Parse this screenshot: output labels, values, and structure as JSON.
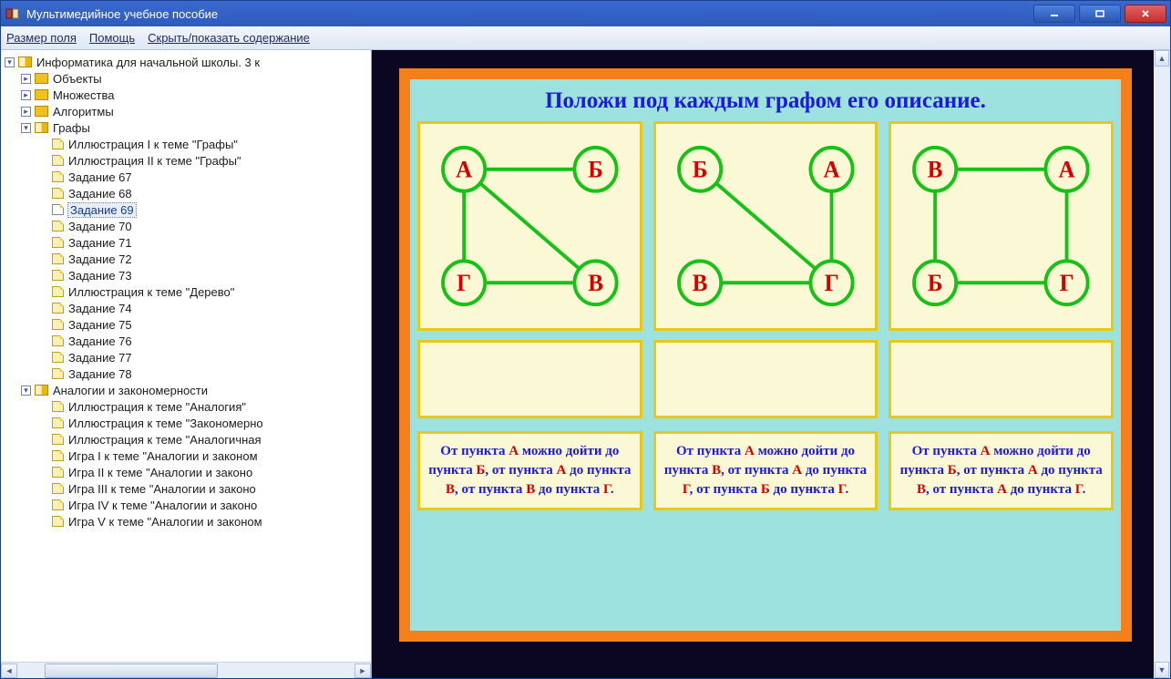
{
  "window_title": "Мультимедийное учебное пособие",
  "menu": {
    "field_size": "Размер поля",
    "help": "Помощь",
    "toggle_toc": "Скрыть/показать содержание"
  },
  "tree": {
    "root": "Информатика для начальной школы. 3 к",
    "ch1": "Объекты",
    "ch2": "Множества",
    "ch3": "Алгоритмы",
    "ch4": "Графы",
    "g_items": [
      "Иллюстрация I к теме \"Графы\"",
      "Иллюстрация II к теме \"Графы\"",
      "Задание 67",
      "Задание 68",
      "Задание 69",
      "Задание 70",
      "Задание 71",
      "Задание 72",
      "Задание 73",
      "Иллюстрация к теме \"Дерево\"",
      "Задание 74",
      "Задание 75",
      "Задание 76",
      "Задание 77",
      "Задание 78"
    ],
    "ch5": "Аналогии и закономерности",
    "a_items": [
      "Иллюстрация к теме \"Аналогия\"",
      "Иллюстрация к теме \"Закономерно",
      "Иллюстрация к теме \"Аналогичная",
      "Игра I к теме \"Аналогии и законом",
      "Игра II к теме \"Аналогии и законо",
      "Игра III к теме \"Аналогии и законо",
      "Игра IV к теме \"Аналогии и законо",
      "Игра V к теме \"Аналогии и законом"
    ]
  },
  "slide": {
    "title": "Положи под каждым графом его описание.",
    "graphs": [
      {
        "labels": {
          "tl": "А",
          "tr": "Б",
          "bl": "Г",
          "br": "В"
        },
        "edges": [
          [
            "tl",
            "tr"
          ],
          [
            "tl",
            "bl"
          ],
          [
            "tl",
            "br"
          ],
          [
            "bl",
            "br"
          ]
        ]
      },
      {
        "labels": {
          "tl": "Б",
          "tr": "А",
          "bl": "В",
          "br": "Г"
        },
        "edges": [
          [
            "tl",
            "br"
          ],
          [
            "tr",
            "br"
          ],
          [
            "bl",
            "br"
          ]
        ]
      },
      {
        "labels": {
          "tl": "В",
          "tr": "А",
          "bl": "Б",
          "br": "Г"
        },
        "edges": [
          [
            "tl",
            "tr"
          ],
          [
            "tl",
            "bl"
          ],
          [
            "tr",
            "br"
          ],
          [
            "bl",
            "br"
          ]
        ]
      }
    ],
    "descs": [
      {
        "pre1": "От пункта ",
        "p11": "А",
        "mid1": " можно дойти до пункта ",
        "p12": "Б",
        "post1": ", от пункта ",
        "p21": "А",
        "mid2": " до пункта ",
        "p22": "В",
        "post2": ", от пункта ",
        "p31": "В",
        "mid3": " до пункта ",
        "p32": "Г",
        "end": "."
      },
      {
        "pre1": "От пункта ",
        "p11": "А",
        "mid1": " можно дойти до пункта ",
        "p12": "В",
        "post1": ", от пункта ",
        "p21": "А",
        "mid2": " до пункта ",
        "p22": "Г",
        "post2": ", от пункта ",
        "p31": "Б",
        "mid3": " до пункта ",
        "p32": "Г",
        "end": "."
      },
      {
        "pre1": "От пункта ",
        "p11": "А",
        "mid1": " можно дойти до пункта ",
        "p12": "Б",
        "post1": ", от пункта ",
        "p21": "А",
        "mid2": " до пункта ",
        "p22": "В",
        "post2": ", от пункта ",
        "p31": "А",
        "mid3": " до пункта ",
        "p32": "Г",
        "end": "."
      }
    ]
  }
}
